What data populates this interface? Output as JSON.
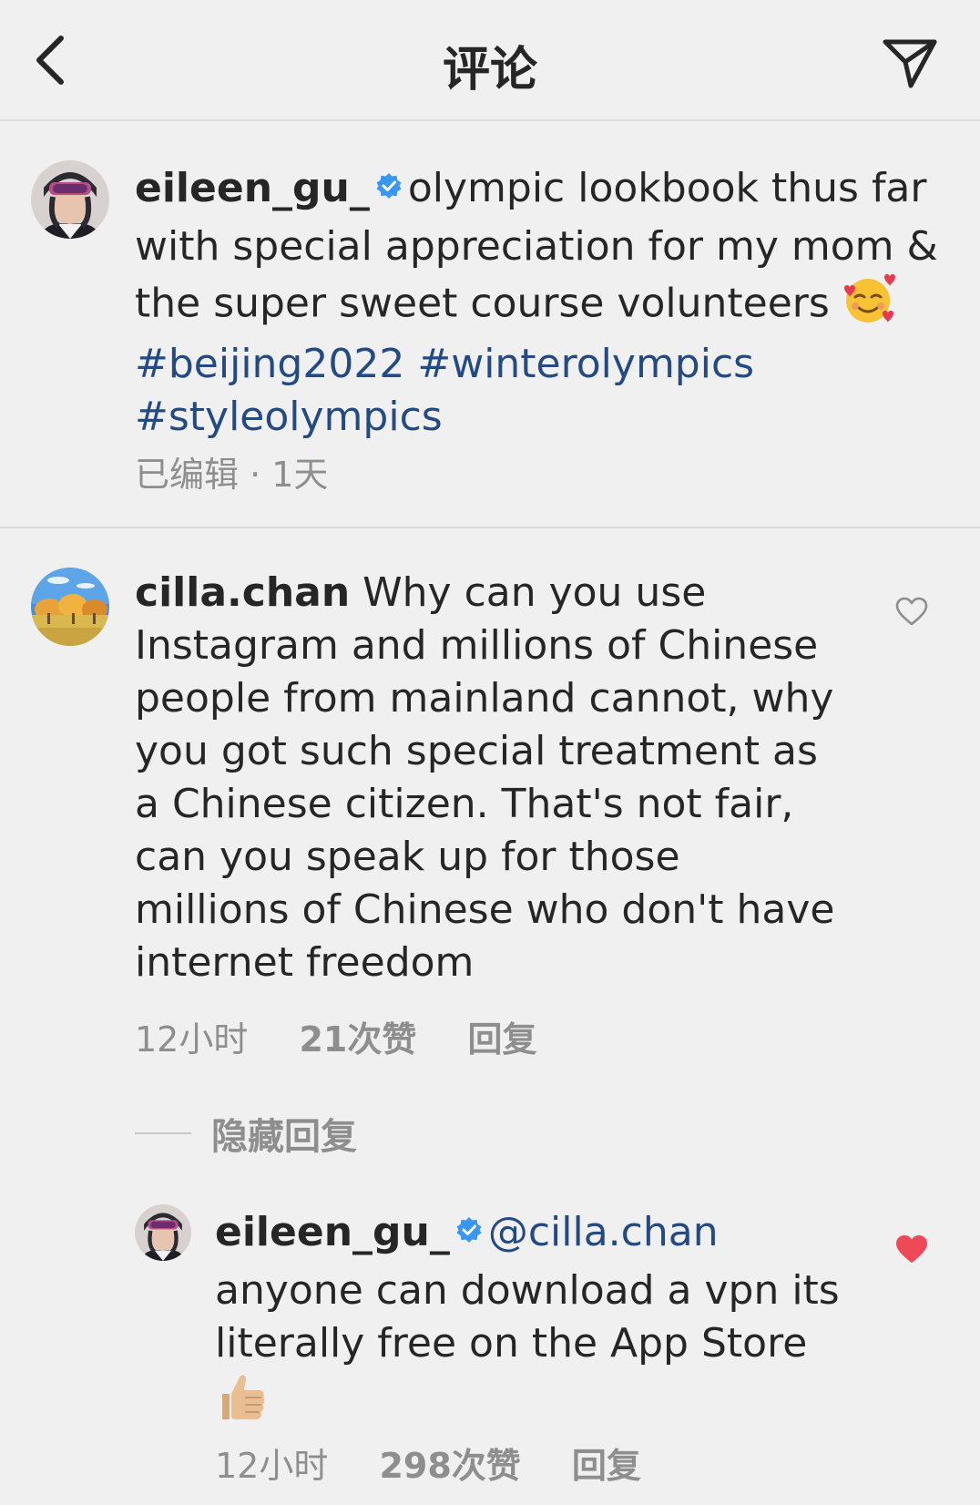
{
  "header": {
    "title": "评论"
  },
  "post": {
    "username": "eileen_gu_",
    "caption_line1": "olympic lookbook thus far",
    "caption_line2": "with special appreciation for my mom &",
    "caption_line3": "the super sweet course volunteers",
    "hashtag1": "#beijing2022",
    "hashtag2": "#winterolympics",
    "hashtag3": "#styleolympics",
    "meta": "已编辑 · 1天"
  },
  "comment": {
    "username": "cilla.chan",
    "lines": [
      "Why can you use",
      "Instagram and millions of Chinese",
      "people from mainland cannot, why",
      "you got such special treatment as",
      "a Chinese citizen. That's not fair,",
      "can you speak up for those",
      "millions of Chinese who don't have",
      "internet freedom"
    ],
    "time": "12小时",
    "likes": "21次赞",
    "reply": "回复",
    "hide_replies": "隐藏回复"
  },
  "reply": {
    "username": "eileen_gu_",
    "mention": "@cilla.chan",
    "lines": [
      "anyone can download a vpn its",
      "literally free on the App Store"
    ],
    "time": "12小时",
    "likes": "298次赞",
    "reply": "回复",
    "liked": true
  },
  "colors": {
    "background": "#f0f0f0",
    "text": "#262626",
    "secondary": "#8e8e8e",
    "hashtag": "#234a82",
    "verified": "#3897f0",
    "heart_liked": "#ed4956"
  },
  "icons": {
    "back": "chevron-left-icon",
    "send": "paper-plane-icon",
    "verified": "verified-badge-icon",
    "heart": "heart-icon",
    "emoji1": "smiling-face-with-hearts-emoji",
    "emoji2": "thumbs-up-emoji"
  }
}
